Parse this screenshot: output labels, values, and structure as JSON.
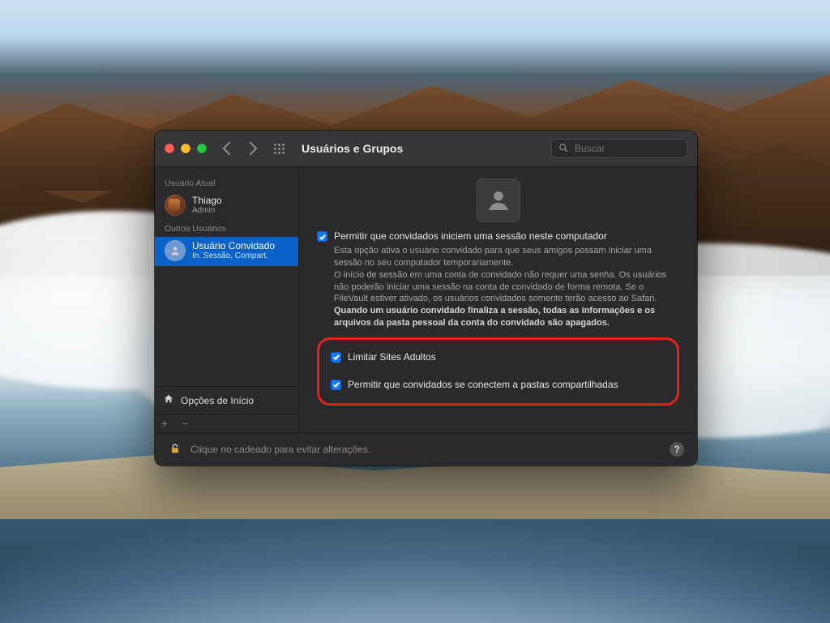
{
  "titlebar": {
    "title": "Usuários e Grupos",
    "search_placeholder": "Buscar"
  },
  "sidebar": {
    "current_user_header": "Usuário Atual",
    "other_users_header": "Outros Usuários",
    "current_user": {
      "name": "Thiago",
      "role": "Admin"
    },
    "guest_user": {
      "name": "Usuário Convidado",
      "role": "In. Sessão, Compart."
    },
    "login_options_label": "Opções de Início",
    "plus_label": "+",
    "minus_label": "−"
  },
  "main": {
    "allow_login_label": "Permitir que convidados iniciem uma sessão neste computador",
    "desc_line1": "Esta opção ativa o usuário convidado para que seus amigos possam iniciar uma sessão no seu computador temporariamente.",
    "desc_line2": "O início de sessão em uma conta de convidado não requer uma senha. Os usuários não poderão iniciar uma sessão na conta de convidado de forma remota. Se o FileVault estiver ativado, os usuários convidados somente terão acesso ao Safari.",
    "desc_bold": "Quando um usuário convidado finaliza a sessão, todas as informações e os arquivos da pasta pessoal da conta do convidado são apagados.",
    "limit_adult_label": "Limitar Sites Adultos",
    "allow_shared_label": "Permitir que convidados se conectem a pastas compartilhadas"
  },
  "footer": {
    "lock_text": "Clique no cadeado para evitar alterações.",
    "help_label": "?"
  }
}
